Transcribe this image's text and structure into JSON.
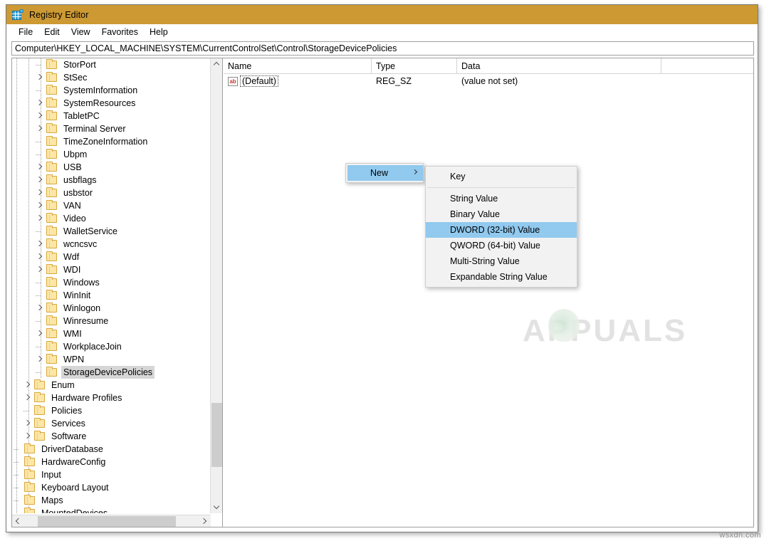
{
  "window": {
    "title": "Registry Editor",
    "icon": "registry-editor-icon",
    "titlebar_color": "#cc9933"
  },
  "menubar": {
    "items": [
      {
        "label": "File"
      },
      {
        "label": "Edit"
      },
      {
        "label": "View"
      },
      {
        "label": "Favorites"
      },
      {
        "label": "Help"
      }
    ]
  },
  "address": {
    "path": "Computer\\HKEY_LOCAL_MACHINE\\SYSTEM\\CurrentControlSet\\Control\\StorageDevicePolicies"
  },
  "tree": {
    "nodes": [
      {
        "label": "StorPort",
        "level": 2,
        "expandable": false,
        "selected": false
      },
      {
        "label": "StSec",
        "level": 2,
        "expandable": true,
        "selected": false
      },
      {
        "label": "SystemInformation",
        "level": 2,
        "expandable": false,
        "selected": false
      },
      {
        "label": "SystemResources",
        "level": 2,
        "expandable": true,
        "selected": false
      },
      {
        "label": "TabletPC",
        "level": 2,
        "expandable": true,
        "selected": false
      },
      {
        "label": "Terminal Server",
        "level": 2,
        "expandable": true,
        "selected": false
      },
      {
        "label": "TimeZoneInformation",
        "level": 2,
        "expandable": false,
        "selected": false
      },
      {
        "label": "Ubpm",
        "level": 2,
        "expandable": false,
        "selected": false
      },
      {
        "label": "USB",
        "level": 2,
        "expandable": true,
        "selected": false
      },
      {
        "label": "usbflags",
        "level": 2,
        "expandable": true,
        "selected": false
      },
      {
        "label": "usbstor",
        "level": 2,
        "expandable": true,
        "selected": false
      },
      {
        "label": "VAN",
        "level": 2,
        "expandable": true,
        "selected": false
      },
      {
        "label": "Video",
        "level": 2,
        "expandable": true,
        "selected": false
      },
      {
        "label": "WalletService",
        "level": 2,
        "expandable": false,
        "selected": false
      },
      {
        "label": "wcncsvc",
        "level": 2,
        "expandable": true,
        "selected": false
      },
      {
        "label": "Wdf",
        "level": 2,
        "expandable": true,
        "selected": false
      },
      {
        "label": "WDI",
        "level": 2,
        "expandable": true,
        "selected": false
      },
      {
        "label": "Windows",
        "level": 2,
        "expandable": false,
        "selected": false
      },
      {
        "label": "WinInit",
        "level": 2,
        "expandable": false,
        "selected": false
      },
      {
        "label": "Winlogon",
        "level": 2,
        "expandable": true,
        "selected": false
      },
      {
        "label": "Winresume",
        "level": 2,
        "expandable": false,
        "selected": false
      },
      {
        "label": "WMI",
        "level": 2,
        "expandable": true,
        "selected": false
      },
      {
        "label": "WorkplaceJoin",
        "level": 2,
        "expandable": false,
        "selected": false
      },
      {
        "label": "WPN",
        "level": 2,
        "expandable": true,
        "selected": false
      },
      {
        "label": "StorageDevicePolicies",
        "level": 2,
        "expandable": false,
        "selected": true
      },
      {
        "label": "Enum",
        "level": 1,
        "expandable": true,
        "selected": false
      },
      {
        "label": "Hardware Profiles",
        "level": 1,
        "expandable": true,
        "selected": false
      },
      {
        "label": "Policies",
        "level": 1,
        "expandable": false,
        "selected": false
      },
      {
        "label": "Services",
        "level": 1,
        "expandable": true,
        "selected": false
      },
      {
        "label": "Software",
        "level": 1,
        "expandable": true,
        "selected": false
      },
      {
        "label": "DriverDatabase",
        "level": 0,
        "expandable": false,
        "selected": false
      },
      {
        "label": "HardwareConfig",
        "level": 0,
        "expandable": false,
        "selected": false
      },
      {
        "label": "Input",
        "level": 0,
        "expandable": false,
        "selected": false
      },
      {
        "label": "Keyboard Layout",
        "level": 0,
        "expandable": false,
        "selected": false
      },
      {
        "label": "Maps",
        "level": 0,
        "expandable": false,
        "selected": false
      },
      {
        "label": "MountedDevices",
        "level": 0,
        "expandable": false,
        "selected": false
      }
    ]
  },
  "list": {
    "columns": [
      {
        "label": "Name"
      },
      {
        "label": "Type"
      },
      {
        "label": "Data"
      }
    ],
    "rows": [
      {
        "name": "(Default)",
        "type": "REG_SZ",
        "data": "(value not set)",
        "icon": "ab-string-icon"
      }
    ]
  },
  "context_menu": {
    "parent": {
      "label": "New",
      "highlighted": true,
      "submenu_indicator": "chevron-right-icon"
    },
    "items": [
      {
        "label": "Key",
        "highlighted": false,
        "separator_after": true
      },
      {
        "label": "String Value",
        "highlighted": false,
        "separator_after": false
      },
      {
        "label": "Binary Value",
        "highlighted": false,
        "separator_after": false
      },
      {
        "label": "DWORD (32-bit) Value",
        "highlighted": true,
        "separator_after": false
      },
      {
        "label": "QWORD (64-bit) Value",
        "highlighted": false,
        "separator_after": false
      },
      {
        "label": "Multi-String Value",
        "highlighted": false,
        "separator_after": false
      },
      {
        "label": "Expandable String Value",
        "highlighted": false,
        "separator_after": false
      }
    ],
    "highlight_color": "#91c9ef"
  },
  "watermarks": {
    "center": "APPUALS",
    "corner": "wsxdn.com"
  }
}
